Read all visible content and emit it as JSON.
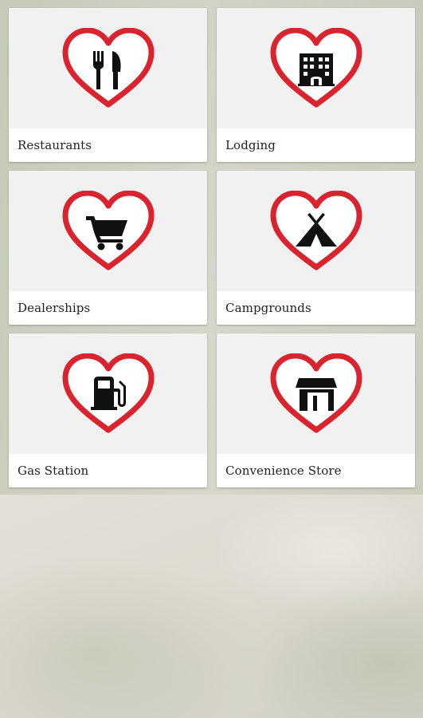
{
  "colors": {
    "heart": "#d9232e",
    "icon": "#111111",
    "tile_bg": "#f1f1f1",
    "label_bg": "#ffffff",
    "label_text": "#222222"
  },
  "categories": [
    {
      "label": "Restaurants",
      "icon": "fork-knife-icon"
    },
    {
      "label": "Lodging",
      "icon": "hotel-icon"
    },
    {
      "label": "Dealerships",
      "icon": "shopping-cart-icon"
    },
    {
      "label": "Campgrounds",
      "icon": "tent-icon"
    },
    {
      "label": "Gas Station",
      "icon": "fuel-pump-icon"
    },
    {
      "label": "Convenience Store",
      "icon": "store-icon"
    }
  ]
}
